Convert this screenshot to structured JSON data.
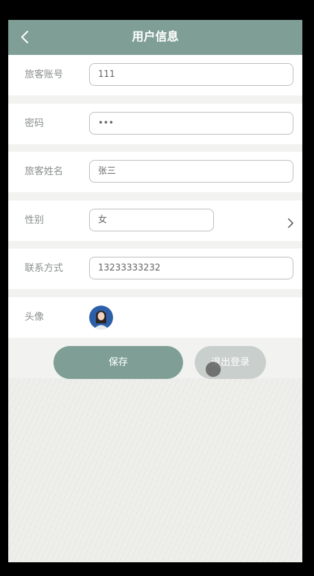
{
  "header": {
    "title": "用户信息",
    "back_icon": "chevron-left-icon"
  },
  "form": {
    "account": {
      "label": "旅客账号",
      "value": "111"
    },
    "password": {
      "label": "密码",
      "value": "•••"
    },
    "name": {
      "label": "旅客姓名",
      "value": "张三"
    },
    "gender": {
      "label": "性别",
      "value": "女",
      "arrow_icon": "chevron-right-icon"
    },
    "contact": {
      "label": "联系方式",
      "value": "13233333232"
    },
    "avatar": {
      "label": "头像",
      "icon": "user-avatar"
    }
  },
  "actions": {
    "save_label": "保存",
    "logout_label": "退出登录"
  },
  "colors": {
    "accent": "#7f9f96",
    "disabled": "#c9cfcd",
    "page_bg": "#f2f2f0"
  }
}
